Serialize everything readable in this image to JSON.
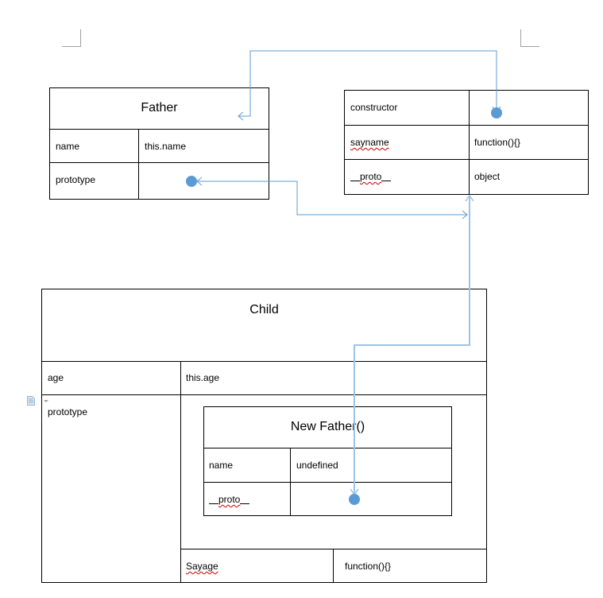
{
  "father": {
    "title": "Father",
    "rows": [
      {
        "key": "name",
        "value": "this.name"
      },
      {
        "key": "prototype",
        "value": ""
      }
    ]
  },
  "prototype_object": {
    "rows": [
      {
        "key": "constructor",
        "value": ""
      },
      {
        "key": "sayname",
        "value": "function(){}"
      },
      {
        "key": "proto",
        "value": "object"
      }
    ]
  },
  "child": {
    "title": "Child",
    "rows": [
      {
        "key": "age",
        "value": "this.age"
      },
      {
        "key": "prototype",
        "value": ""
      }
    ],
    "method": {
      "key": "Sayage",
      "value": "function(){}"
    }
  },
  "new_father": {
    "title": "New Father()",
    "rows": [
      {
        "key": "name",
        "value": "undefined"
      },
      {
        "key": "proto",
        "value": ""
      }
    ]
  },
  "colors": {
    "connector": "#5b9bd5",
    "connector_light": "#9dc3e6",
    "dot": "#5b9bd5",
    "spellcheck": "#d00000"
  }
}
